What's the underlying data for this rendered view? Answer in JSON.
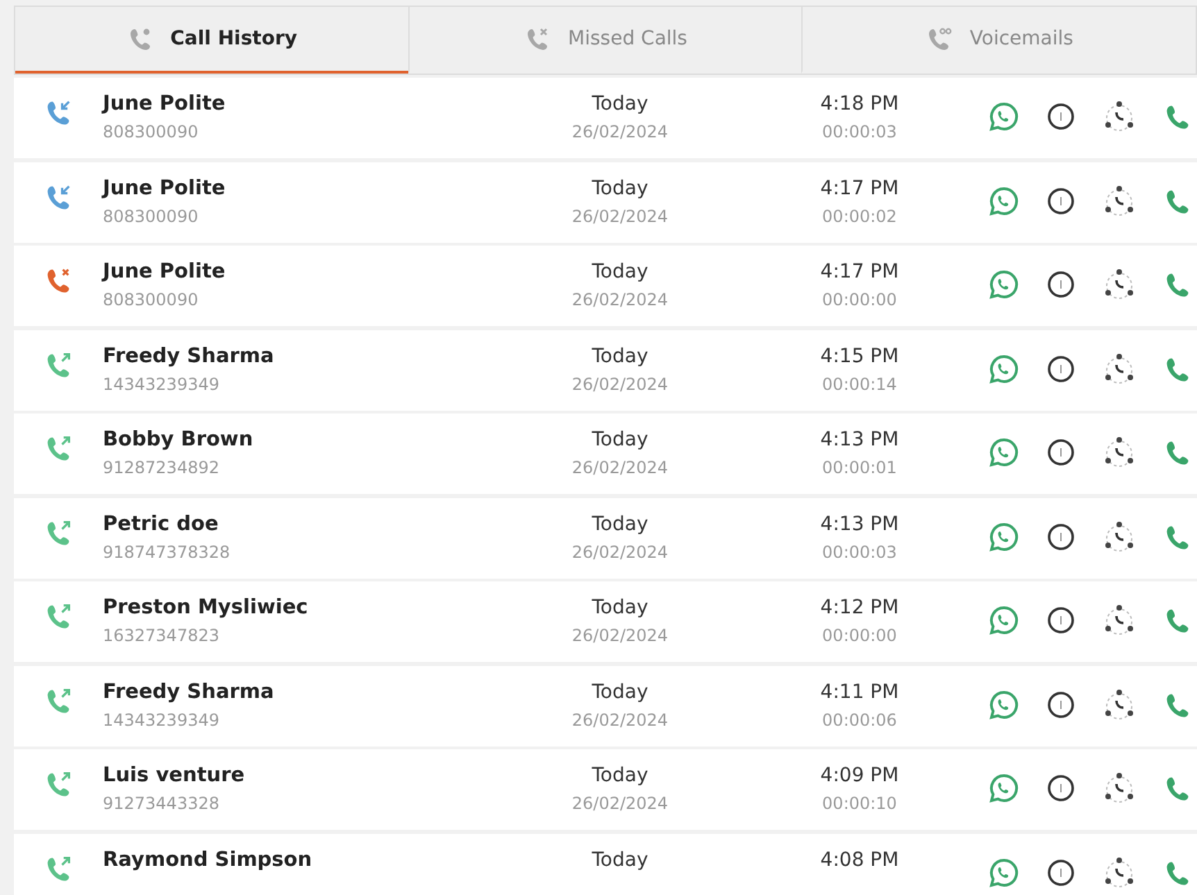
{
  "tabs": [
    {
      "label": "Call History",
      "kind": "history",
      "selected": true
    },
    {
      "label": "Missed Calls",
      "kind": "missed",
      "selected": false
    },
    {
      "label": "Voicemails",
      "kind": "voicemail",
      "selected": false
    }
  ],
  "calls": [
    {
      "kind": "incoming",
      "name": "June Polite",
      "number": "808300090",
      "day": "Today",
      "date": "26/02/2024",
      "time": "4:18 PM",
      "duration": "00:00:03"
    },
    {
      "kind": "incoming",
      "name": "June Polite",
      "number": "808300090",
      "day": "Today",
      "date": "26/02/2024",
      "time": "4:17 PM",
      "duration": "00:00:02"
    },
    {
      "kind": "missed",
      "name": "June Polite",
      "number": "808300090",
      "day": "Today",
      "date": "26/02/2024",
      "time": "4:17 PM",
      "duration": "00:00:00"
    },
    {
      "kind": "outgoing",
      "name": "Freedy Sharma",
      "number": "14343239349",
      "day": "Today",
      "date": "26/02/2024",
      "time": "4:15 PM",
      "duration": "00:00:14"
    },
    {
      "kind": "outgoing",
      "name": "Bobby Brown",
      "number": "91287234892",
      "day": "Today",
      "date": "26/02/2024",
      "time": "4:13 PM",
      "duration": "00:00:01"
    },
    {
      "kind": "outgoing",
      "name": "Petric doe",
      "number": "918747378328",
      "day": "Today",
      "date": "26/02/2024",
      "time": "4:13 PM",
      "duration": "00:00:03"
    },
    {
      "kind": "outgoing",
      "name": "Preston Mysliwiec",
      "number": "16327347823",
      "day": "Today",
      "date": "26/02/2024",
      "time": "4:12 PM",
      "duration": "00:00:00"
    },
    {
      "kind": "outgoing",
      "name": "Freedy Sharma",
      "number": "14343239349",
      "day": "Today",
      "date": "26/02/2024",
      "time": "4:11 PM",
      "duration": "00:00:06"
    },
    {
      "kind": "outgoing",
      "name": "Luis venture",
      "number": "91273443328",
      "day": "Today",
      "date": "26/02/2024",
      "time": "4:09 PM",
      "duration": "00:00:10"
    },
    {
      "kind": "outgoing",
      "name": "Raymond Simpson",
      "day": "Today",
      "time": "4:08 PM"
    }
  ]
}
